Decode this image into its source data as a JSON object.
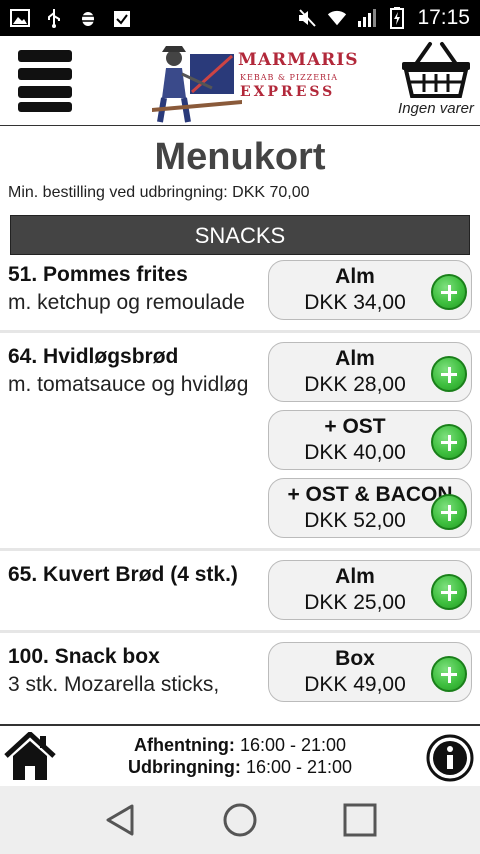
{
  "status_bar": {
    "time": "17:15",
    "icons": [
      "image-icon",
      "usb-icon",
      "android-debug-icon",
      "clipboard-check-icon",
      "mute-icon",
      "wifi-icon",
      "signal-icon",
      "battery-icon"
    ]
  },
  "header": {
    "logo_line1": "MARMARIS",
    "logo_line2": "KEBAB & PIZZERIA",
    "logo_line3": "EXPRESS",
    "cart_label": "Ingen varer"
  },
  "page": {
    "title": "Menukort",
    "min_order": "Min. bestilling ved udbringning: DKK 70,00"
  },
  "section": {
    "title": "SNACKS"
  },
  "items": [
    {
      "name": "51. Pommes frites",
      "description": "m. ketchup og remoulade",
      "variants": [
        {
          "name": "Alm",
          "price": "DKK 34,00"
        }
      ]
    },
    {
      "name": "64. Hvidløgsbrød",
      "description": "m. tomatsauce og hvidløg",
      "variants": [
        {
          "name": "Alm",
          "price": "DKK 28,00"
        },
        {
          "name": "+ OST",
          "price": "DKK 40,00"
        },
        {
          "name": "+ OST & BACON",
          "price": "DKK 52,00"
        }
      ]
    },
    {
      "name": "65. Kuvert Brød (4 stk.)",
      "description": "",
      "variants": [
        {
          "name": "Alm",
          "price": "DKK 25,00"
        }
      ]
    },
    {
      "name": "100. Snack box",
      "description": "3 stk. Mozarella sticks,",
      "variants": [
        {
          "name": "Box",
          "price": "DKK 49,00"
        }
      ]
    }
  ],
  "footer": {
    "pickup_label": "Afhentning:",
    "pickup_hours": "16:00 - 21:00",
    "delivery_label": "Udbringning:",
    "delivery_hours": "16:00 - 21:00"
  },
  "colors": {
    "section_bar": "#444444",
    "add_button": "#3fbf3f",
    "logo_red": "#b2283a"
  }
}
